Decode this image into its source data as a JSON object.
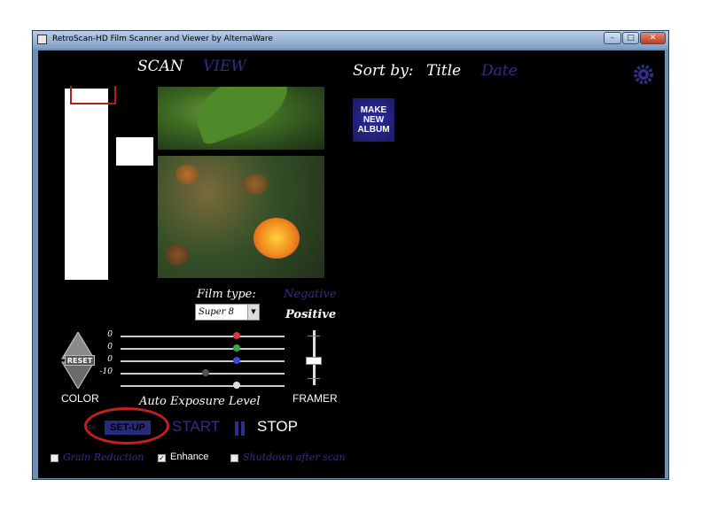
{
  "window": {
    "title": "RetroScan-HD Film Scanner and Viewer by AlternaWare",
    "buttons": {
      "minimize": "–",
      "maximize": "□",
      "close": "✕"
    }
  },
  "tabs": {
    "scan": "SCAN",
    "view": "VIEW",
    "active": "scan"
  },
  "film": {
    "label": "Film type:",
    "selected": "Super 8",
    "negative": "Negative",
    "positive": "Positive"
  },
  "sliders": [
    {
      "value": "0",
      "color": "#d93b3b",
      "level": 0.71
    },
    {
      "value": "0",
      "color": "#3aa83a",
      "level": 0.71
    },
    {
      "value": "0",
      "color": "#4444dd",
      "level": 0.71
    },
    {
      "value": "-10",
      "color": "#555555",
      "level": 0.52
    },
    {
      "value": "",
      "color": "#dddddd",
      "level": 0.71
    }
  ],
  "controls": {
    "reset": "RESET",
    "color": "COLOR",
    "auto_exposure": "Auto Exposure Level",
    "framer": "FRAMER",
    "framer_level": 0.55,
    "setup": "SET-UP",
    "back_arrow": "⇦",
    "start": "START",
    "stop": "STOP"
  },
  "options": [
    {
      "label": "Grain Reduction",
      "checked": false,
      "color": "#2f2f8a"
    },
    {
      "label": "Enhance",
      "checked": true,
      "color": "#ffffff"
    },
    {
      "label": "Shutdown after scan",
      "checked": false,
      "color": "#2f2f8a"
    }
  ],
  "sort": {
    "label": "Sort by:",
    "title": "Title",
    "date": "Date"
  },
  "album": {
    "line1": "MAKE",
    "line2": "NEW",
    "line3": "ALBUM"
  },
  "colors": {
    "accent": "#2f2f8a",
    "annotation": "#c81e1e",
    "background": "#000000"
  }
}
